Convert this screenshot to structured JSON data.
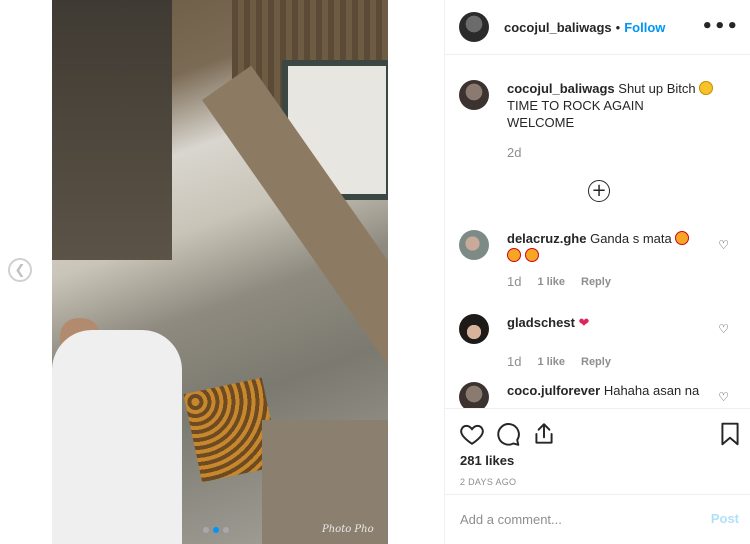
{
  "header": {
    "username": "cocojul_baliwags",
    "separator": "•",
    "follow_label": "Follow",
    "more_icon": "more-options-icon"
  },
  "media": {
    "watermark": "Photo Pho",
    "carousel_dots": 3,
    "active_dot": 2
  },
  "caption": {
    "username": "cocojul_baliwags",
    "line1": "Shut up Bitch",
    "line2": "TIME TO ROCK AGAIN",
    "line3": "WELCOME",
    "time": "2d"
  },
  "comments": [
    {
      "username": "delacruz.ghe",
      "text": "Ganda s mata",
      "age": "1d",
      "likes": "1 like",
      "reply": "Reply"
    },
    {
      "username": "gladschest",
      "text": "",
      "age": "1d",
      "likes": "1 like",
      "reply": "Reply"
    },
    {
      "username": "coco.julforever",
      "text": "Hahaha asan na"
    }
  ],
  "stats": {
    "likes": "281 likes",
    "date": "2 DAYS AGO"
  },
  "add_comment": {
    "placeholder": "Add a comment...",
    "post_label": "Post"
  },
  "colors": {
    "accent": "#0095f6",
    "muted": "#8e8e8e",
    "post_disabled": "#b2dffc"
  }
}
